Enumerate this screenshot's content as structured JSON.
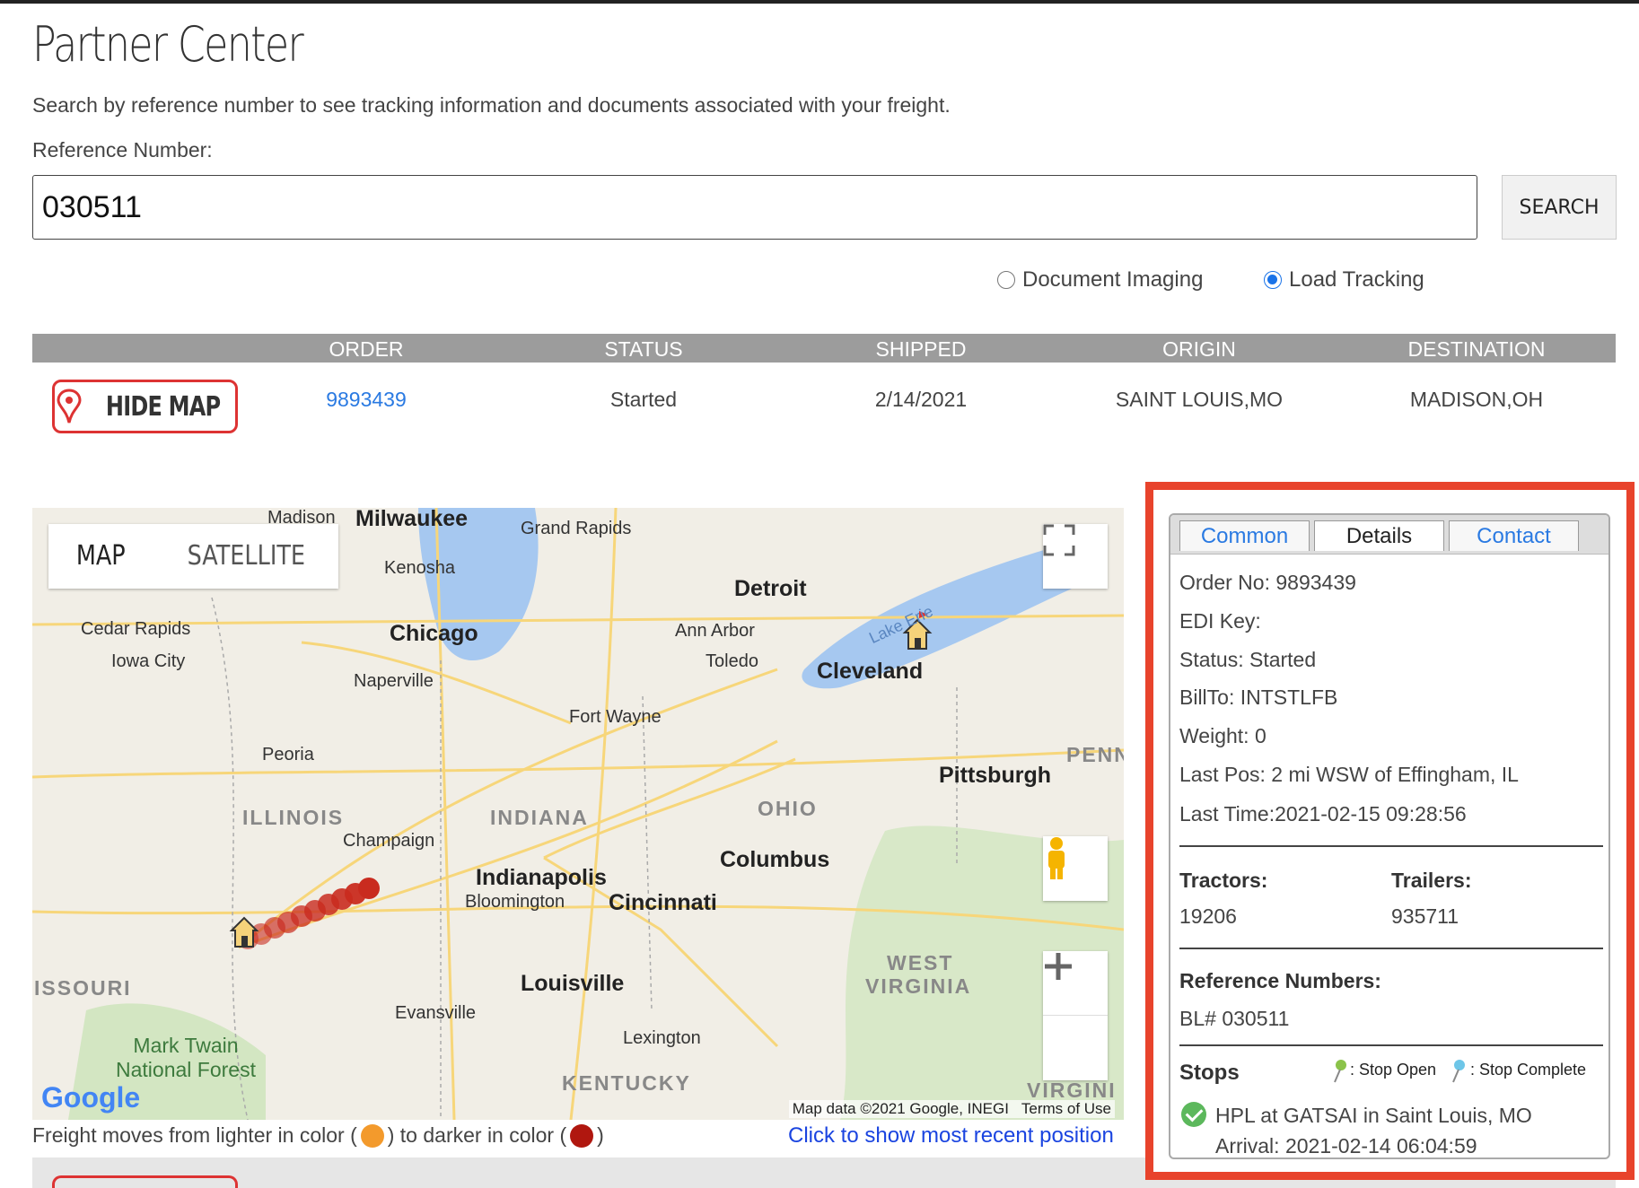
{
  "header": {
    "title": "Partner Center",
    "subtitle": "Search by reference number to see tracking information and documents associated with your freight.",
    "ref_label": "Reference Number:"
  },
  "search": {
    "value": "030511",
    "button_label": "SEARCH"
  },
  "radios": {
    "document_imaging": "Document Imaging",
    "load_tracking": "Load Tracking",
    "selected": "Load Tracking"
  },
  "table": {
    "headers": [
      "ORDER",
      "STATUS",
      "SHIPPED",
      "ORIGIN",
      "DESTINATION"
    ],
    "row": {
      "order": "9893439",
      "status": "Started",
      "shipped": "2/14/2021",
      "origin": "SAINT LOUIS,MO",
      "destination": "MADISON,OH"
    },
    "hide_map_label": "HIDE MAP"
  },
  "map": {
    "type_map": "MAP",
    "type_satellite": "SATELLITE",
    "attribution": "Map data ©2021 Google, INEGI",
    "terms": "Terms of Use",
    "google": "Google",
    "cities": {
      "madison": "Madison",
      "milwaukee": "Milwaukee",
      "grand_rapids": "Grand Rapids",
      "kenosha": "Kenosha",
      "detroit": "Detroit",
      "cedar_rapids": "Cedar Rapids",
      "iowa_city": "Iowa City",
      "chicago": "Chicago",
      "ann_arbor": "Ann Arbor",
      "toledo": "Toledo",
      "naperville": "Naperville",
      "cleveland": "Cleveland",
      "fort_wayne": "Fort Wayne",
      "peoria": "Peoria",
      "pittsburgh": "Pittsburgh",
      "champaign": "Champaign",
      "indianapolis": "Indianapolis",
      "columbus": "Columbus",
      "bloomington": "Bloomington",
      "cincinnati": "Cincinnati",
      "louisville": "Louisville",
      "evansville": "Evansville",
      "lexington": "Lexington",
      "mark_twain": "Mark Twain National Forest",
      "lake_erie": "Lake Erie"
    },
    "states": {
      "illinois": "ILLINOIS",
      "indiana": "INDIANA",
      "ohio": "OHIO",
      "penn": "PENN",
      "west_virginia_1": "WEST",
      "west_virginia_2": "VIRGINIA",
      "missouri": "ISSOURI",
      "kentucky": "KENTUCKY",
      "virginia": "VIRGINI"
    }
  },
  "legend": {
    "prefix": "Freight moves from lighter in color (",
    "middle": ") to darker in color (",
    "suffix": ")",
    "light_color": "#f39a2c",
    "dark_color": "#b0170f",
    "recent_link": "Click to show most recent position"
  },
  "panel": {
    "tabs": [
      "Common",
      "Details",
      "Contact"
    ],
    "active_tab": "Details",
    "order_no": "Order No: 9893439",
    "edi_key": "EDI Key:",
    "status": "Status: Started",
    "bill_to": "BillTo: INTSTLFB",
    "weight": "Weight: 0",
    "last_pos": "Last Pos: 2 mi WSW of Effingham, IL",
    "last_time": "Last Time:2021-02-15 09:28:56",
    "tractors_label": "Tractors:",
    "tractors_value": "19206",
    "trailers_label": "Trailers:",
    "trailers_value": "935711",
    "ref_numbers_label": "Reference Numbers:",
    "ref_numbers_value": "BL# 030511",
    "stops_label": "Stops",
    "stop_open": ": Stop Open",
    "stop_complete": ": Stop Complete",
    "stop_1": "HPL at GATSAI in Saint Louis, MO",
    "stop_1_arrival": "Arrival: 2021-02-14 06:04:59"
  },
  "colors": {
    "highlight": "#e8432c",
    "link": "#2a7ae2",
    "header_bg": "#9c9c9c"
  }
}
